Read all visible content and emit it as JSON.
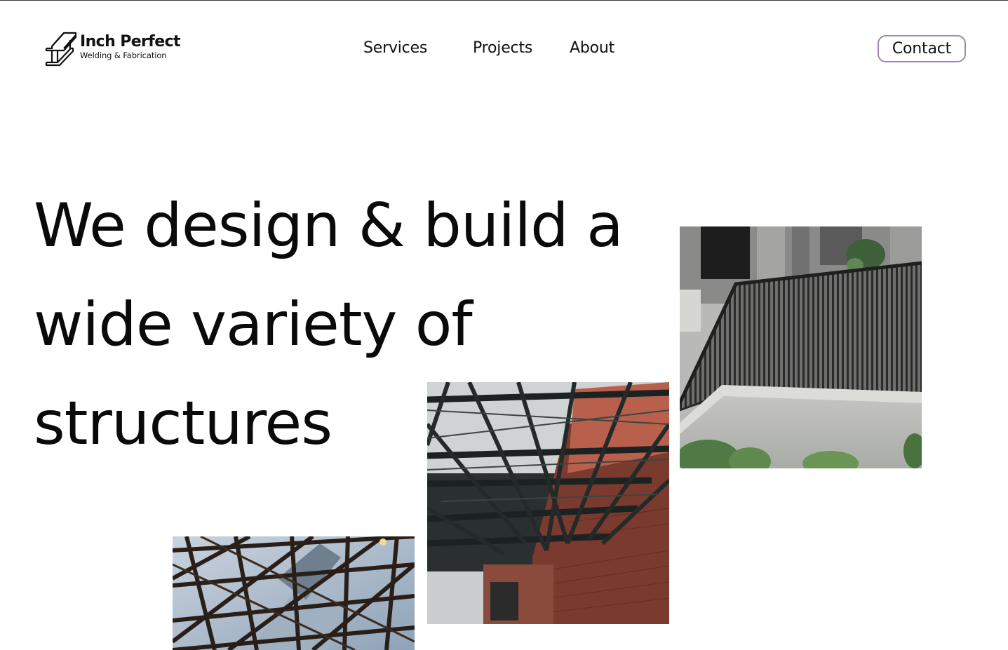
{
  "brand": {
    "name": "Inch Perfect",
    "tagline": "Welding & Fabrication",
    "logo_icon": "steel-i-beam-icon"
  },
  "nav": {
    "items": [
      {
        "label": "Services"
      },
      {
        "label": "Projects"
      },
      {
        "label": "About"
      }
    ],
    "contact_label": "Contact"
  },
  "hero": {
    "title_lines": [
      "We design & build a",
      "wide variety of",
      "structures"
    ]
  },
  "gallery": [
    {
      "subject": "stair-railing-photo"
    },
    {
      "subject": "steel-roof-truss-photo"
    },
    {
      "subject": "glass-roof-lattice-photo"
    }
  ],
  "colors": {
    "text": "#111111",
    "contact_border": "#a284b5",
    "background": "#ffffff"
  }
}
